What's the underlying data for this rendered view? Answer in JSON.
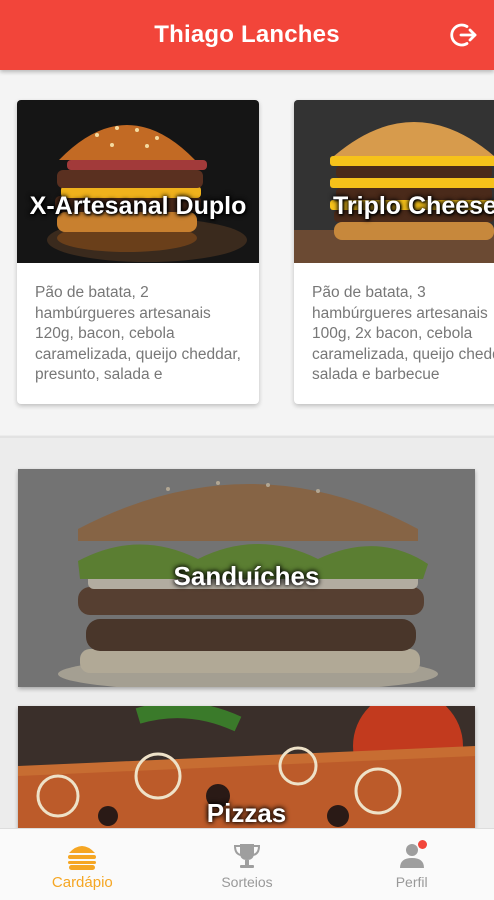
{
  "app": {
    "title": "Thiago Lanches"
  },
  "colors": {
    "primary": "#f2453a",
    "accent": "#f5a623",
    "muted": "#999999"
  },
  "header": {
    "logout_icon": "logout-icon"
  },
  "featured": [
    {
      "name": "X-Artesanal  Duplo",
      "description": "Pão de batata, 2 hambúrgueres artesanais 120g, bacon, cebola caramelizada, queijo cheddar, presunto, salada e"
    },
    {
      "name": "Triplo Cheese",
      "description": "Pão de batata, 3 hambúrgueres artesanais 100g, 2x bacon, cebola caramelizada, queijo cheddar, salada e barbecue"
    }
  ],
  "categories": [
    {
      "name": "Sanduíches"
    },
    {
      "name": "Pizzas"
    }
  ],
  "bottom_nav": [
    {
      "label": "Cardápio",
      "icon": "burger-icon",
      "active": true
    },
    {
      "label": "Sorteios",
      "icon": "trophy-icon",
      "active": false
    },
    {
      "label": "Perfil",
      "icon": "person-icon",
      "active": false,
      "has_notification": true
    }
  ]
}
